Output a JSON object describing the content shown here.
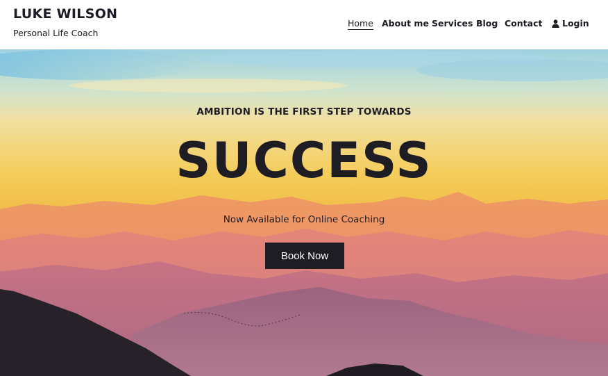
{
  "brand": {
    "name": "LUKE WILSON",
    "tagline": "Personal Life Coach"
  },
  "nav": {
    "items": [
      {
        "label": "Home",
        "active": true
      },
      {
        "label": "About me",
        "active": false
      },
      {
        "label": "Services",
        "active": false
      },
      {
        "label": "Blog",
        "active": false
      },
      {
        "label": "Contact",
        "active": false
      }
    ],
    "login": {
      "label": "Login",
      "icon": "user-icon"
    }
  },
  "hero": {
    "kicker": "AMBITION IS THE FIRST STEP TOWARDS",
    "title": "SUCCESS",
    "subtitle": "Now Available for Online Coaching",
    "cta": "Book Now",
    "background": "sunset-mountains"
  },
  "colors": {
    "text": "#1e1a24",
    "button": "#1f1d24",
    "sky_top": "#8ecbe0",
    "sky_mid": "#f3c24a",
    "mountains": "#e98a6e"
  }
}
